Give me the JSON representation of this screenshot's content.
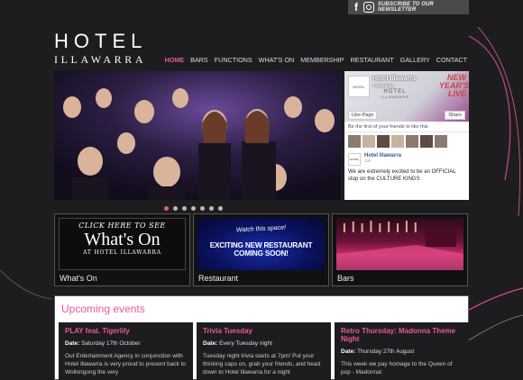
{
  "topbar": {
    "facebook_icon": "facebook-icon",
    "instagram_icon": "instagram-icon",
    "newsletter_label": "SUBSCRIBE TO OUR NEWSLETTER"
  },
  "logo": {
    "line1": "HOTEL",
    "line2": "ILLAWARRA"
  },
  "nav": {
    "items": [
      "HOME",
      "BARS",
      "FUNCTIONS",
      "WHAT'S ON",
      "MEMBERSHIP",
      "RESTAURANT",
      "GALLERY",
      "CONTACT"
    ],
    "active": "HOME"
  },
  "colors": {
    "accent": "#e8589b",
    "background": "#1d1d1f"
  },
  "facebook_widget": {
    "page_name": "Hotel Illawarra",
    "likes": "4,664 likes",
    "cover_text_1": "HOTEL",
    "cover_text_2": "ILLAWARRA",
    "cover_new": "NEW YEAR'S LIVE",
    "like_button": "Like Page",
    "share_button": "Share",
    "friends_line": "Be the first of your friends to like this",
    "post_author": "Hotel Illawarra",
    "post_time": "13h",
    "post_text": "We are extremely excited to be an OFFICIAL stop on the CULTURE KINGS"
  },
  "slider": {
    "slide_count": 7,
    "active_index": 0
  },
  "tiles": [
    {
      "label": "What's On",
      "caption_1": "Click here to see",
      "caption_2": "What's On",
      "caption_3": "AT HOTEL ILLAWARRA"
    },
    {
      "label": "Restaurant",
      "caption_1": "Watch this space!",
      "caption_2": "EXCITING NEW RESTAURANT COMING SOON!"
    },
    {
      "label": "Bars"
    }
  ],
  "events": {
    "heading": "Upcoming events",
    "items": [
      {
        "title": "PLAY feat. Tigerlily",
        "date_label": "Date:",
        "date": "Saturday 17th October",
        "excerpt": "Out Entertainment Agency in conjunction with Hotel Illawarra is very proud to present back to Wollongong the very"
      },
      {
        "title": "Trivia Tuesday",
        "date_label": "Date:",
        "date": "Every Tuesday night",
        "excerpt": "Tuesday night trivia starts at 7pm! Put your thinking caps on, grab your friends, and head down to Hotel Illawarra for a night"
      },
      {
        "title": "Retro Thursday: Madonna Theme Night",
        "date_label": "Date:",
        "date": "Thursday 27th August",
        "excerpt": "This week we pay homage to the Queen of pop - Madonna!"
      }
    ]
  }
}
